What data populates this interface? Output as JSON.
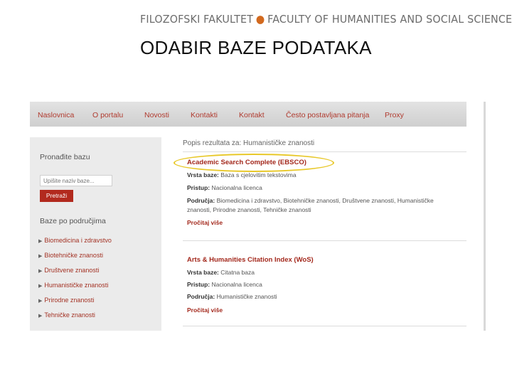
{
  "banner": {
    "left": "FILOZOFSKI FAKULTET",
    "right": "FACULTY OF HUMANITIES AND SOCIAL SCIENCES"
  },
  "slide_title": "ODABIR BAZE PODATAKA",
  "nav": {
    "items": [
      "Naslovnica",
      "O portalu",
      "Novosti",
      "Kontakti",
      "Kontakt",
      "Često postavljana pitanja",
      "Proxy"
    ]
  },
  "sidebar": {
    "search_label": "Pronađite bazu",
    "search_placeholder": "Upišite naziv baze...",
    "search_button": "Pretraži",
    "categories_label": "Baze po područjima",
    "categories": [
      "Biomedicina i zdravstvo",
      "Biotehničke znanosti",
      "Društvene znanosti",
      "Humanističke znanosti",
      "Prirodne znanosti",
      "Tehničke znanosti"
    ]
  },
  "results": {
    "header": "Popis rezultata za: Humanističke znanosti",
    "items": [
      {
        "title": "Academic Search Complete (EBSCO)",
        "type_label": "Vrsta baze:",
        "type": "Baza s cjelovitim tekstovima",
        "access_label": "Pristup:",
        "access": "Nacionalna licenca",
        "areas_label": "Područja:",
        "areas": "Biomedicina i zdravstvo, Biotehničke znanosti, Društvene znanosti, Humanističke",
        "areas_cont": "znanosti, Prirodne znanosti, Tehničke znanosti",
        "more": "Pročitaj više"
      },
      {
        "title": "Arts & Humanities Citation Index (WoS)",
        "type_label": "Vrsta baze:",
        "type": "Citatna baza",
        "access_label": "Pristup:",
        "access": "Nacionalna licenca",
        "areas_label": "Područja:",
        "areas": "Humanističke znanosti",
        "more": "Pročitaj više"
      }
    ]
  },
  "colors": {
    "accent": "#a3281c",
    "highlight": "#e8c829",
    "nav_bg": "#d8d8d8",
    "sidebar_bg": "#ebebeb"
  }
}
